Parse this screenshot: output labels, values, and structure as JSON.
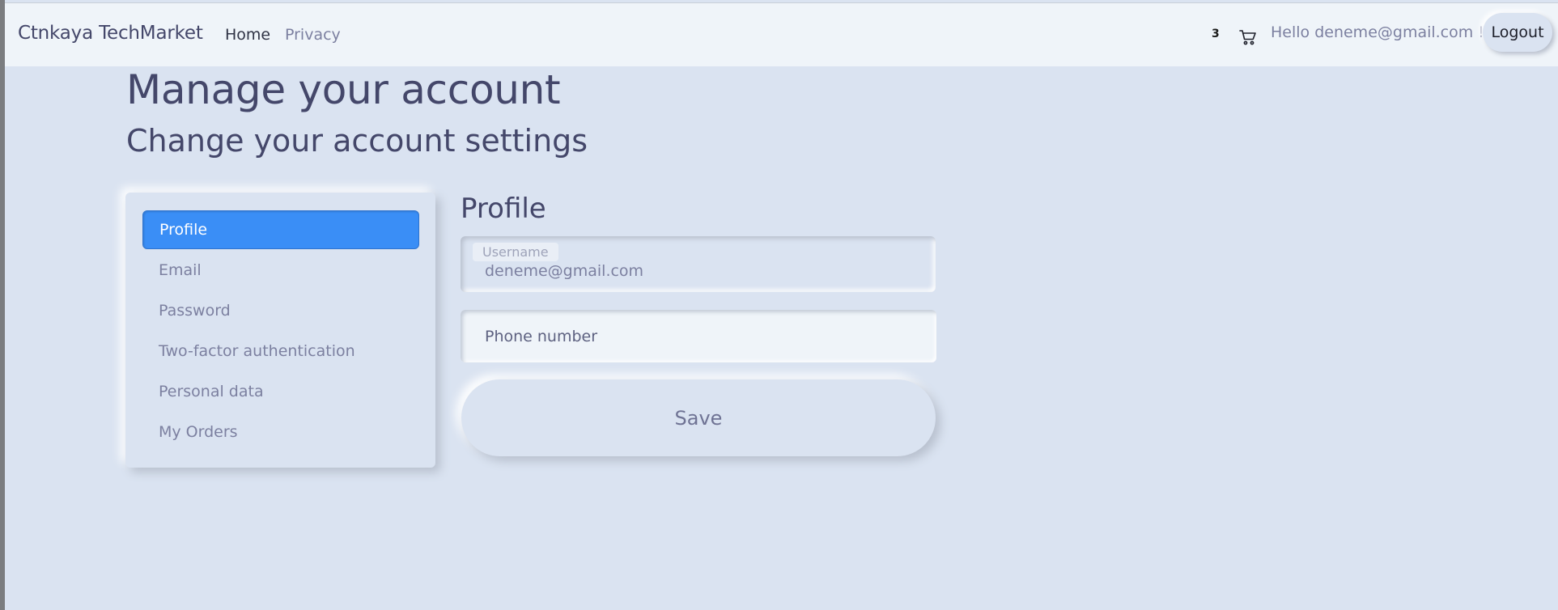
{
  "navbar": {
    "brand": "Ctnkaya TechMarket",
    "links": [
      "Home",
      "Privacy"
    ],
    "cart_count": "3",
    "greeting": "Hello deneme@gmail.com !",
    "logout_label": "Logout"
  },
  "page": {
    "title": "Manage your account",
    "subtitle": "Change your account settings"
  },
  "sidebar": {
    "items": [
      {
        "label": "Profile",
        "active": true
      },
      {
        "label": "Email",
        "active": false
      },
      {
        "label": "Password",
        "active": false
      },
      {
        "label": "Two-factor authentication",
        "active": false
      },
      {
        "label": "Personal data",
        "active": false
      },
      {
        "label": "My Orders",
        "active": false
      }
    ]
  },
  "profile": {
    "heading": "Profile",
    "username_label": "Username",
    "username_value": "deneme@gmail.com",
    "phone_placeholder": "Phone number",
    "save_label": "Save"
  },
  "colors": {
    "background": "#dae3f1",
    "navbar": "#eff4f9",
    "accent": "#3a8ef6",
    "text": "#44476a"
  }
}
